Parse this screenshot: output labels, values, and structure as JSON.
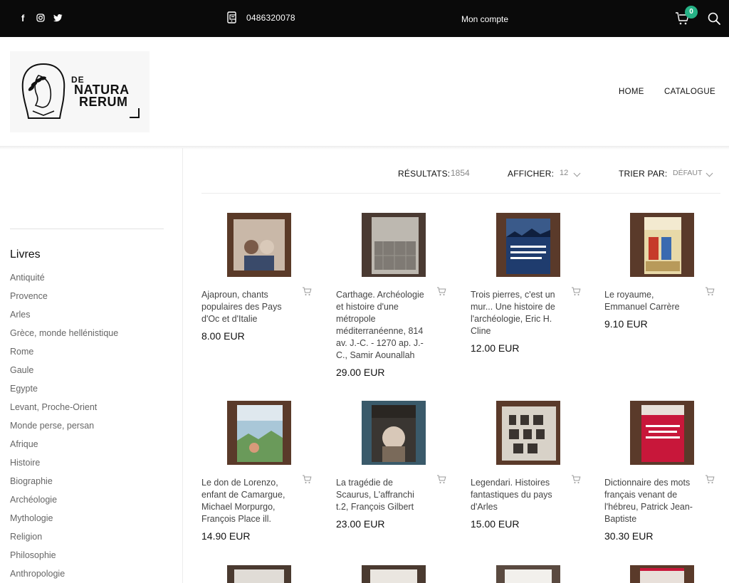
{
  "topbar": {
    "social_icons": [
      "facebook-icon",
      "instagram-icon",
      "twitter-icon"
    ],
    "phone": "0486320078",
    "account": "Mon compte",
    "cart_count": "0"
  },
  "brand": {
    "line1": "DE",
    "line2": "NATURA",
    "line3": "RERUM"
  },
  "nav": {
    "home": "HOME",
    "catalogue": "CATALOGUE"
  },
  "sidebar": {
    "title": "Livres",
    "items": [
      "Antiquité",
      "Provence",
      "Arles",
      "Grèce, monde hellénistique",
      "Rome",
      "Gaule",
      "Egypte",
      "Levant, Proche-Orient",
      "Monde perse, persan",
      "Afrique",
      "Histoire",
      "Biographie",
      "Archéologie",
      "Mythologie",
      "Religion",
      "Philosophie",
      "Anthropologie"
    ]
  },
  "toolbar": {
    "results_label": "RÉSULTATS:",
    "results_count": "1854",
    "show_label": "AFFICHER:",
    "show_value": "12",
    "sort_label": "TRIER PAR:",
    "sort_value": "DÉFAUT"
  },
  "products": [
    {
      "name": "Ajaproun, chants populaires des Pays d'Oc et d'Italie",
      "price": "8.00 EUR",
      "cover_color": "#c9b8a8"
    },
    {
      "name": "Carthage. Archéologie et histoire d'une métropole méditerranéenne, 814 av. J.-C. - 1270 ap. J.-C., Samir Aounallah",
      "price": "29.00 EUR",
      "cover_color": "#8a8580"
    },
    {
      "name": "Trois pierres, c'est un mur... Une histoire de l'archéologie, Eric H. Cline",
      "price": "12.00 EUR",
      "cover_color": "#1f3c6e"
    },
    {
      "name": "Le royaume, Emmanuel Carrère",
      "price": "9.10 EUR",
      "cover_color": "#e8d9a8"
    },
    {
      "name": "Le don de Lorenzo, enfant de Camargue, Michael Morpurgo, François Place ill.",
      "price": "14.90 EUR",
      "cover_color": "#a9c7d8"
    },
    {
      "name": "La tragédie de Scaurus, L'affranchi t.2, François Gilbert",
      "price": "23.00 EUR",
      "cover_color": "#3a3632"
    },
    {
      "name": "Legendari. Histoires fantastiques du pays d'Arles",
      "price": "15.00 EUR",
      "cover_color": "#d8d2c8"
    },
    {
      "name": "Dictionnaire des mots français venant de l'hébreu, Patrick Jean-Baptiste",
      "price": "30.30 EUR",
      "cover_color": "#c8173a"
    }
  ]
}
